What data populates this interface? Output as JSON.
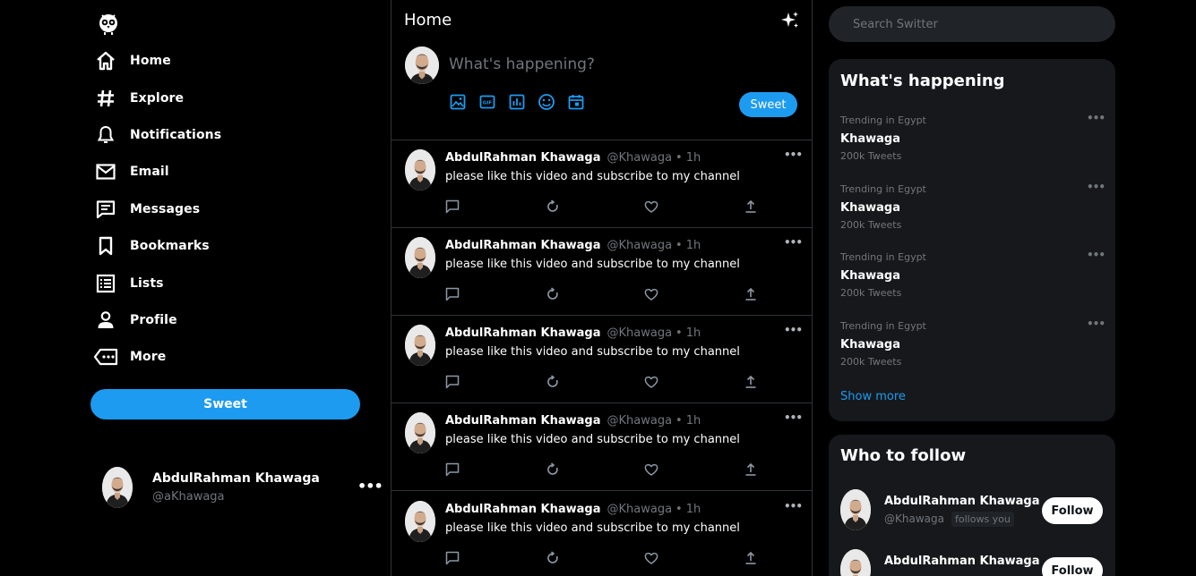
{
  "sidebar": {
    "logo_icon": "owl-logo-icon",
    "items": [
      {
        "label": "Home",
        "icon": "home-icon"
      },
      {
        "label": "Explore",
        "icon": "hashtag-icon"
      },
      {
        "label": "Notifications",
        "icon": "bell-icon"
      },
      {
        "label": "Email",
        "icon": "envelope-icon"
      },
      {
        "label": "Messages",
        "icon": "message-icon"
      },
      {
        "label": "Bookmarks",
        "icon": "bookmark-icon"
      },
      {
        "label": "Lists",
        "icon": "list-icon"
      },
      {
        "label": "Profile",
        "icon": "person-icon"
      },
      {
        "label": "More",
        "icon": "more-icon"
      }
    ],
    "sweet_button": "Sweet",
    "account": {
      "name": "AbdulRahman Khawaga",
      "handle": "@aKhawaga"
    }
  },
  "feed": {
    "title": "Home",
    "compose": {
      "placeholder": "What's happening?",
      "tools": [
        "image-icon",
        "gif-icon",
        "poll-icon",
        "emoji-icon",
        "schedule-icon"
      ],
      "sweet_button": "Sweet"
    },
    "posts": [
      {
        "author": "AbdulRahman Khawaga",
        "handle": "@Khawaga",
        "separator": "•",
        "time": "1h",
        "text": "please like this video and subscribe to my channel"
      },
      {
        "author": "AbdulRahman Khawaga",
        "handle": "@Khawaga",
        "separator": "•",
        "time": "1h",
        "text": "please like this video and subscribe to my channel"
      },
      {
        "author": "AbdulRahman Khawaga",
        "handle": "@Khawaga",
        "separator": "•",
        "time": "1h",
        "text": "please like this video and subscribe to my channel"
      },
      {
        "author": "AbdulRahman Khawaga",
        "handle": "@Khawaga",
        "separator": "•",
        "time": "1h",
        "text": "please like this video and subscribe to my channel"
      },
      {
        "author": "AbdulRahman Khawaga",
        "handle": "@Khawaga",
        "separator": "•",
        "time": "1h",
        "text": "please like this video and subscribe to my channel"
      }
    ]
  },
  "search": {
    "placeholder": "Search Switter"
  },
  "trends": {
    "title": "What's happening",
    "items": [
      {
        "context": "Trending in Egypt",
        "topic": "Khawaga",
        "count": "200k Tweets"
      },
      {
        "context": "Trending in Egypt",
        "topic": "Khawaga",
        "count": "200k Tweets"
      },
      {
        "context": "Trending in Egypt",
        "topic": "Khawaga",
        "count": "200k Tweets"
      },
      {
        "context": "Trending in Egypt",
        "topic": "Khawaga",
        "count": "200k Tweets"
      }
    ],
    "show_more": "Show more"
  },
  "who_to_follow": {
    "title": "Who to follow",
    "items": [
      {
        "name": "AbdulRahman Khawaga",
        "handle": "@Khawaga",
        "follows_you": "follows you",
        "button": "Follow"
      },
      {
        "name": "AbdulRahman Khawaga",
        "handle": "",
        "follows_you": "",
        "button": "Follow"
      }
    ]
  },
  "colors": {
    "accent": "#1d9bf0",
    "background": "#000000",
    "panel": "#16181c",
    "muted": "#71767b"
  }
}
